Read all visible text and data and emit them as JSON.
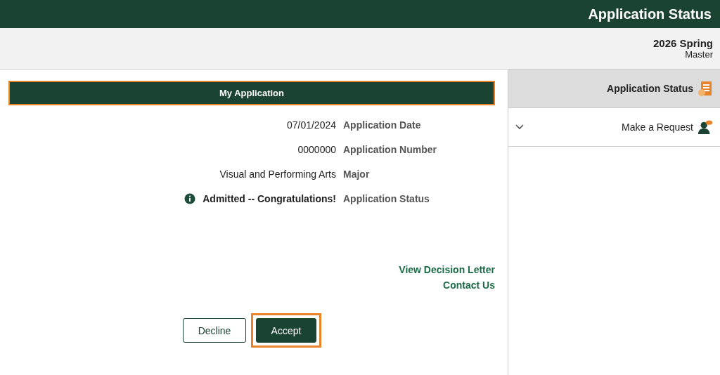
{
  "header": {
    "title": "Application Status"
  },
  "term": {
    "name": "2026 Spring",
    "career": "Master"
  },
  "sidebar": {
    "items": [
      {
        "label": "Application Status",
        "selected": true,
        "kind": "status",
        "expandable": false
      },
      {
        "label": "Make a Request",
        "selected": false,
        "kind": "request",
        "expandable": true
      }
    ]
  },
  "panel": {
    "title": "My Application"
  },
  "fields": [
    {
      "label": "Application Date",
      "value": "07/01/2024",
      "bold": false,
      "info": false
    },
    {
      "label": "Application Number",
      "value": "0000000",
      "bold": false,
      "info": false
    },
    {
      "label": "Major",
      "value": "Visual and Performing Arts",
      "bold": false,
      "info": false
    },
    {
      "label": "Application Status",
      "value": "Admitted -- Congratulations!",
      "bold": true,
      "info": true
    }
  ],
  "links": [
    "View Decision Letter",
    "Contact Us"
  ],
  "buttons": [
    {
      "label": "Decline",
      "primary": false,
      "highlighted": false
    },
    {
      "label": "Accept",
      "primary": true,
      "highlighted": true
    }
  ]
}
